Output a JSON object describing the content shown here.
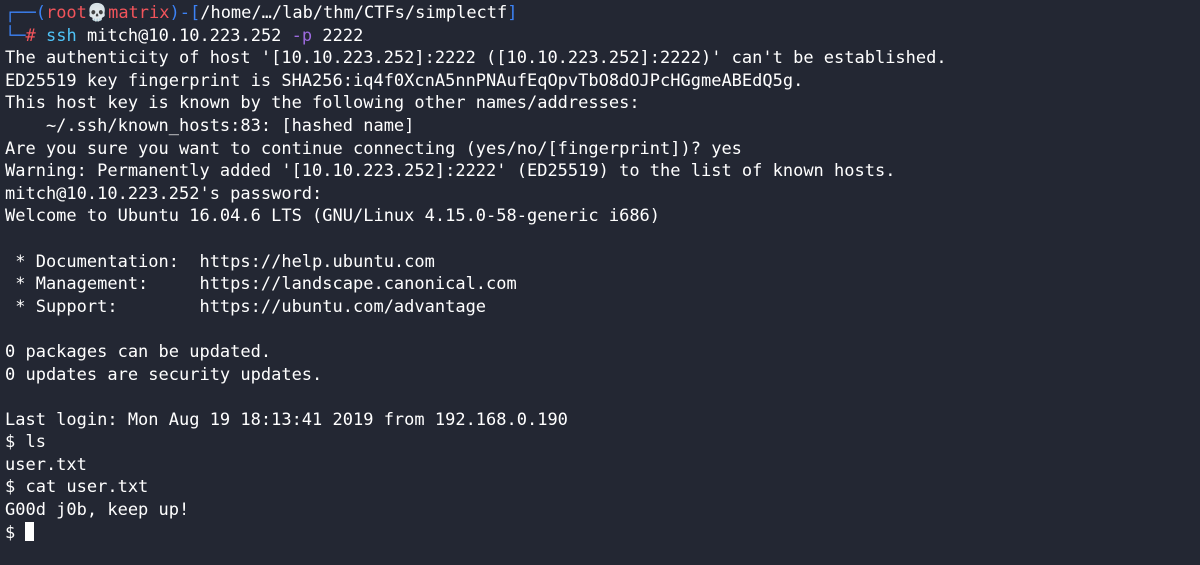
{
  "prompt": {
    "top_prefix": "┌──(",
    "user": "root",
    "skull": "💀",
    "host": "matrix",
    "mid": ")-[",
    "path": "/home/…/lab/thm/CTFs/simplectf",
    "close": "]",
    "bottom_prefix": "└─",
    "hash": "#"
  },
  "command": {
    "name": "ssh",
    "target": "mitch@10.10.223.252",
    "flag": "-p",
    "port": "2222"
  },
  "output": [
    "The authenticity of host '[10.10.223.252]:2222 ([10.10.223.252]:2222)' can't be established.",
    "ED25519 key fingerprint is SHA256:iq4f0XcnA5nnPNAufEqOpvTbO8dOJPcHGgmeABEdQ5g.",
    "This host key is known by the following other names/addresses:",
    "    ~/.ssh/known_hosts:83: [hashed name]",
    "Are you sure you want to continue connecting (yes/no/[fingerprint])? yes",
    "Warning: Permanently added '[10.10.223.252]:2222' (ED25519) to the list of known hosts.",
    "mitch@10.10.223.252's password:",
    "Welcome to Ubuntu 16.04.6 LTS (GNU/Linux 4.15.0-58-generic i686)",
    "",
    " * Documentation:  https://help.ubuntu.com",
    " * Management:     https://landscape.canonical.com",
    " * Support:        https://ubuntu.com/advantage",
    "",
    "0 packages can be updated.",
    "0 updates are security updates.",
    "",
    "Last login: Mon Aug 19 18:13:41 2019 from 192.168.0.190",
    "$ ls",
    "user.txt",
    "$ cat user.txt",
    "G00d j0b, keep up!"
  ],
  "final_prompt": "$ "
}
